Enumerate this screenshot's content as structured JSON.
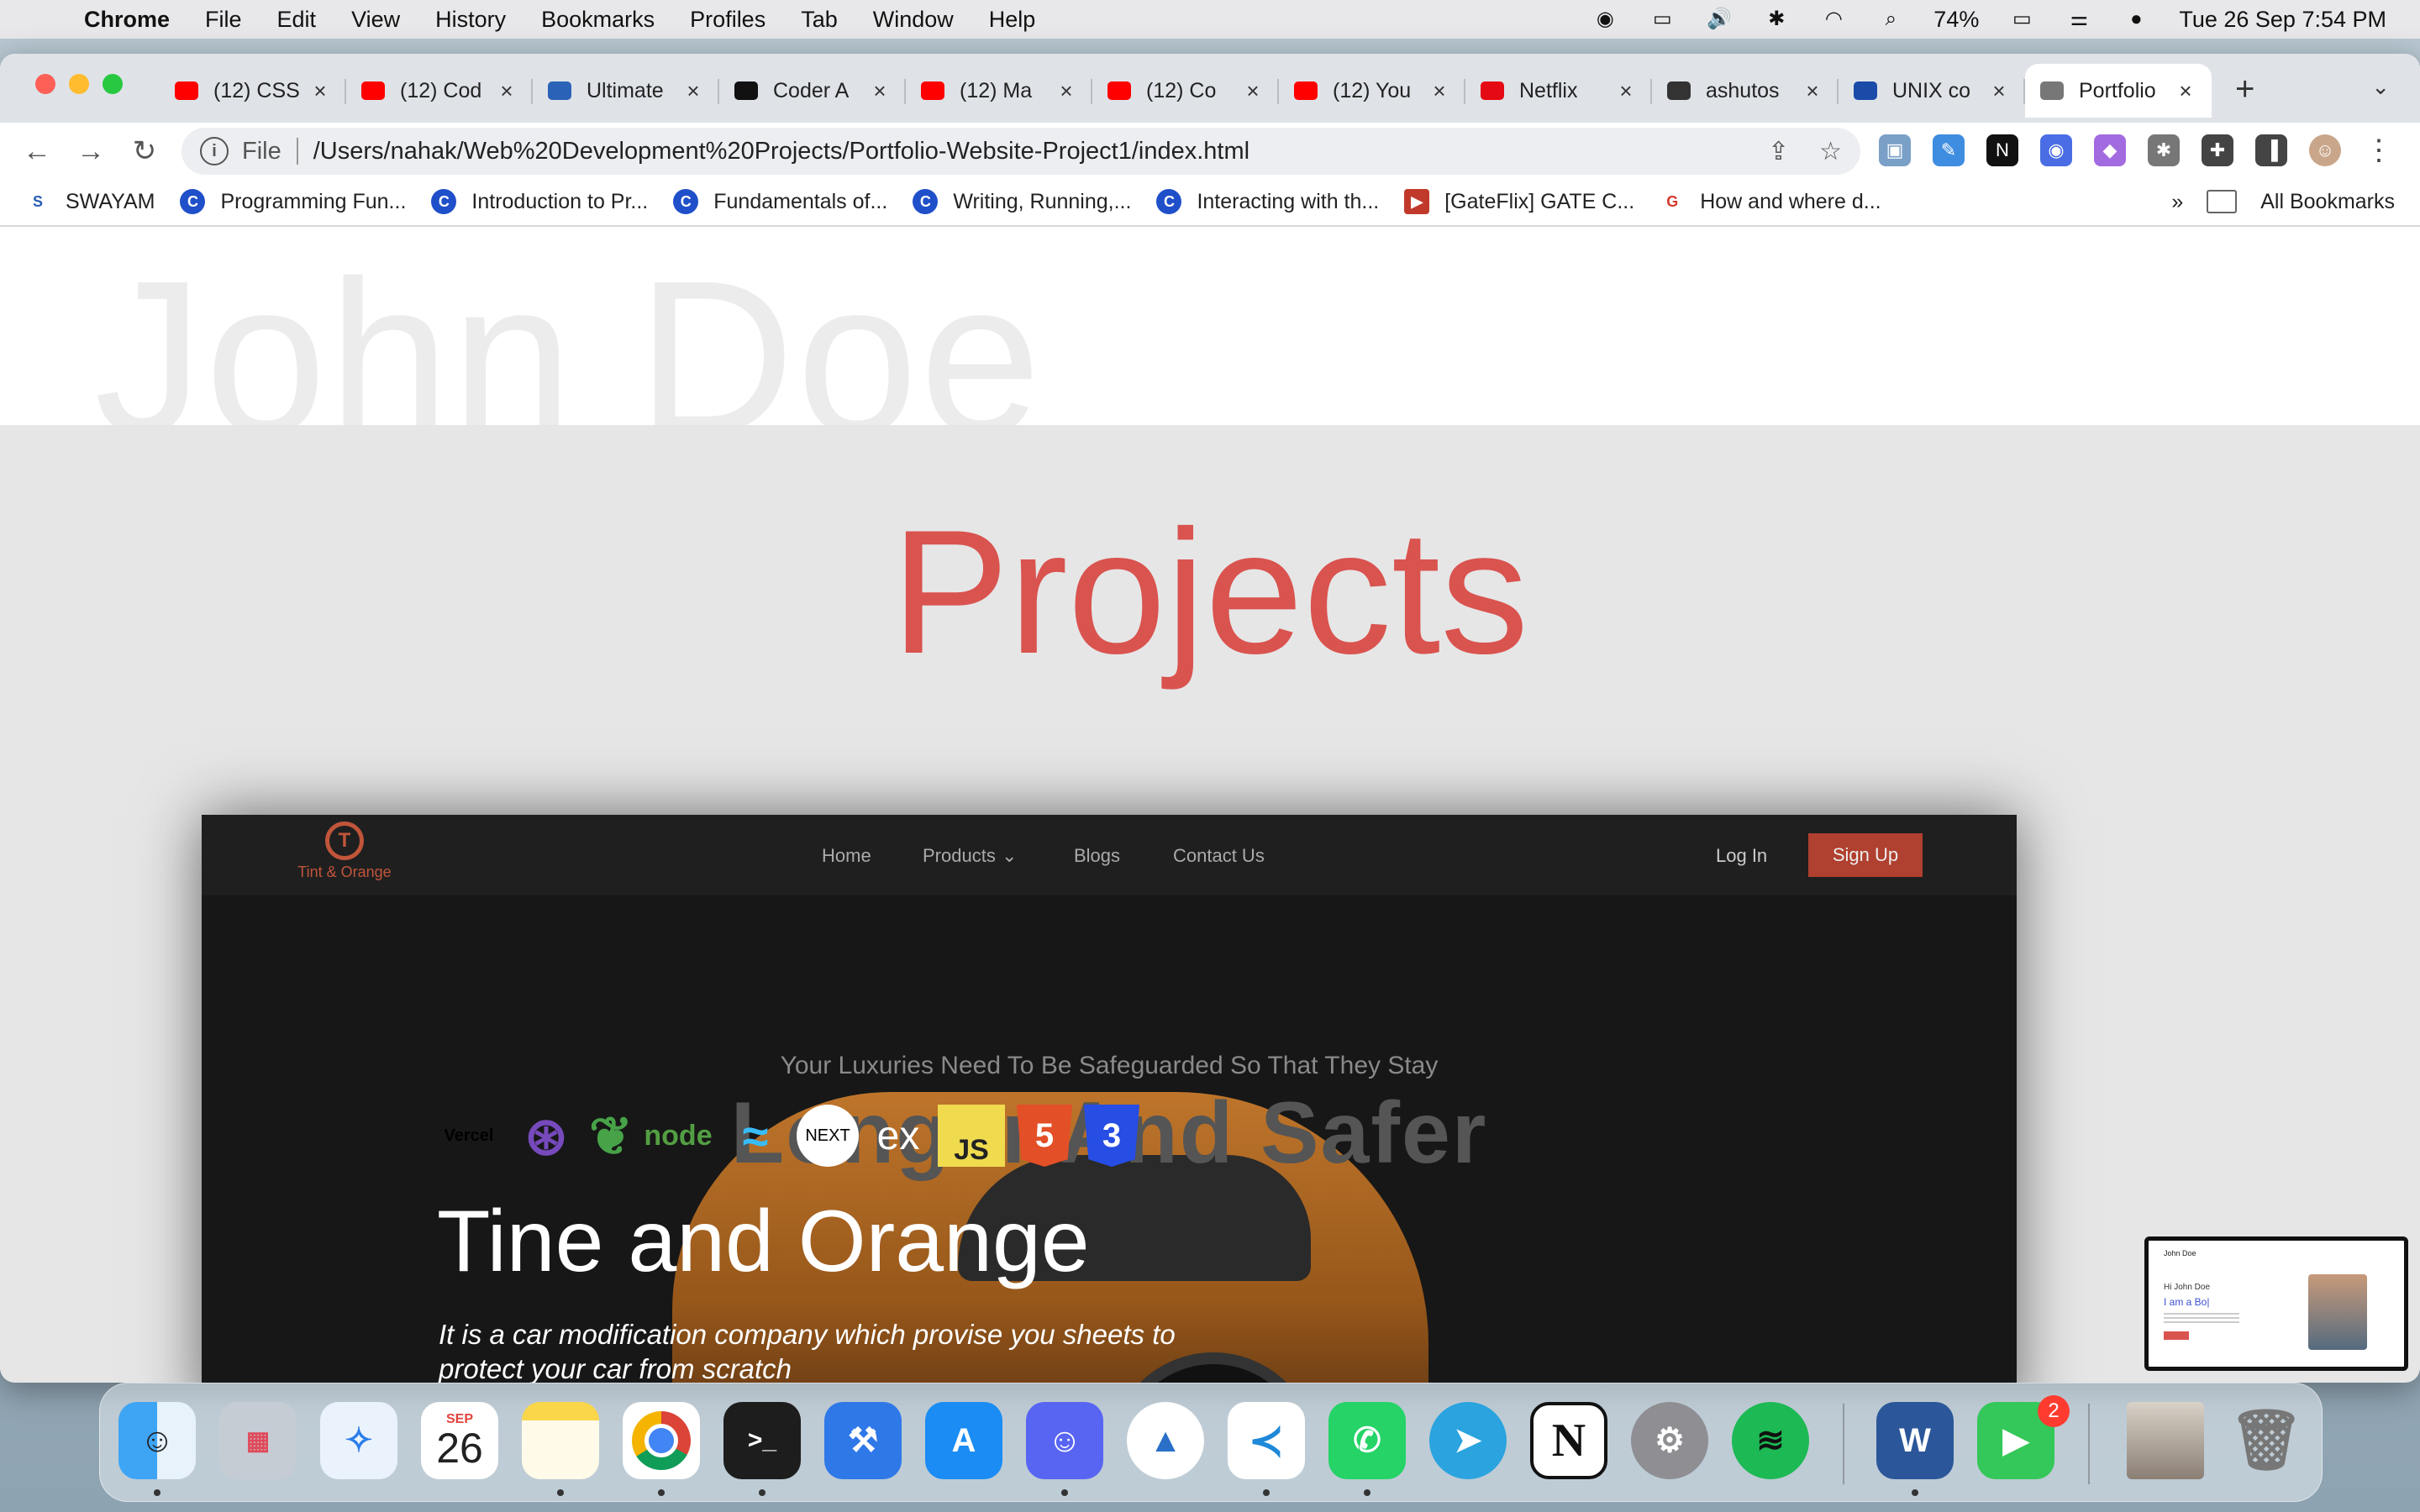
{
  "menubar": {
    "app": "Chrome",
    "items": [
      "File",
      "Edit",
      "View",
      "History",
      "Bookmarks",
      "Profiles",
      "Tab",
      "Window",
      "Help"
    ],
    "battery": "74%",
    "clock": "Tue 26 Sep  7:54 PM"
  },
  "browser": {
    "tabs": [
      {
        "label": "(12) CSS",
        "favicon": "youtube-icon",
        "color": "#ff0000"
      },
      {
        "label": "(12) Cod",
        "favicon": "youtube-icon",
        "color": "#ff0000"
      },
      {
        "label": "Ultimate",
        "favicon": "tata-icon",
        "color": "#2a62b8"
      },
      {
        "label": "Coder A",
        "favicon": "coder-icon",
        "color": "#111111"
      },
      {
        "label": "(12) Ma",
        "favicon": "youtube-icon",
        "color": "#ff0000"
      },
      {
        "label": "(12) Co",
        "favicon": "youtube-icon",
        "color": "#ff0000"
      },
      {
        "label": "(12) You",
        "favicon": "youtube-icon",
        "color": "#ff0000"
      },
      {
        "label": "Netflix",
        "favicon": "netflix-icon",
        "color": "#e50914"
      },
      {
        "label": "ashutos",
        "favicon": "github-icon",
        "color": "#333333"
      },
      {
        "label": "UNIX co",
        "favicon": "unix-icon",
        "color": "#1a4ba8"
      },
      {
        "label": "Portfolio",
        "favicon": "globe-icon",
        "color": "#777777",
        "active": true
      }
    ],
    "url_scheme": "File",
    "url": "/Users/nahak/Web%20Development%20Projects/Portfolio-Website-Project1/index.html",
    "bookmarks": [
      {
        "label": "SWAYAM",
        "color": "#2a5db0",
        "glyph": "S"
      },
      {
        "label": "Programming Fun...",
        "color": "#1f4fc9",
        "glyph": "C"
      },
      {
        "label": "Introduction to Pr...",
        "color": "#1f4fc9",
        "glyph": "C"
      },
      {
        "label": "Fundamentals of...",
        "color": "#1f4fc9",
        "glyph": "C"
      },
      {
        "label": "Writing, Running,...",
        "color": "#1f4fc9",
        "glyph": "C"
      },
      {
        "label": "Interacting with th...",
        "color": "#1f4fc9",
        "glyph": "C"
      },
      {
        "label": "[GateFlix] GATE C...",
        "color": "#c0392b",
        "glyph": "▶"
      },
      {
        "label": "How and where d...",
        "color": "#d63a2f",
        "glyph": "G"
      }
    ],
    "bookmarks_overflow": "»",
    "all_bookmarks": "All Bookmarks"
  },
  "page": {
    "ghost_name": "John Doe",
    "section_title": "Projects",
    "project": {
      "site_nav": {
        "logo_text": "Tint & Orange",
        "links": [
          "Home",
          "Products",
          "Blogs",
          "Contact Us"
        ],
        "login": "Log In",
        "signup": "Sign Up"
      },
      "tagline": "Your Luxuries Need To Be Safeguarded So That They Stay",
      "slogan": "Longer And Safer",
      "tech_stack": [
        "Vercel",
        "Redux",
        "MongoDB",
        "node",
        "Tailwind",
        "NEXT",
        "ex",
        "JS",
        "HTML5",
        "CSS3"
      ],
      "name": "Tine and Orange",
      "description": "It is a car modification company which provise you sheets to protect your car from scratch"
    }
  },
  "pip_preview": {
    "title": "John Doe",
    "greeting": "Hi John Doe",
    "role": "I am a Bo|"
  },
  "dock": {
    "apps": [
      "Finder",
      "Launchpad",
      "Safari",
      "Calendar",
      "Notes",
      "Chrome",
      "Terminal",
      "Xcode",
      "App Store",
      "Discord",
      "Android Studio",
      "VS Code",
      "WhatsApp",
      "Telegram",
      "Notion",
      "System Settings",
      "Spotify",
      "Word",
      "FaceTime",
      "Downloads",
      "Trash"
    ],
    "calendar_month": "SEP",
    "calendar_day": "26",
    "facetime_badge": "2"
  }
}
